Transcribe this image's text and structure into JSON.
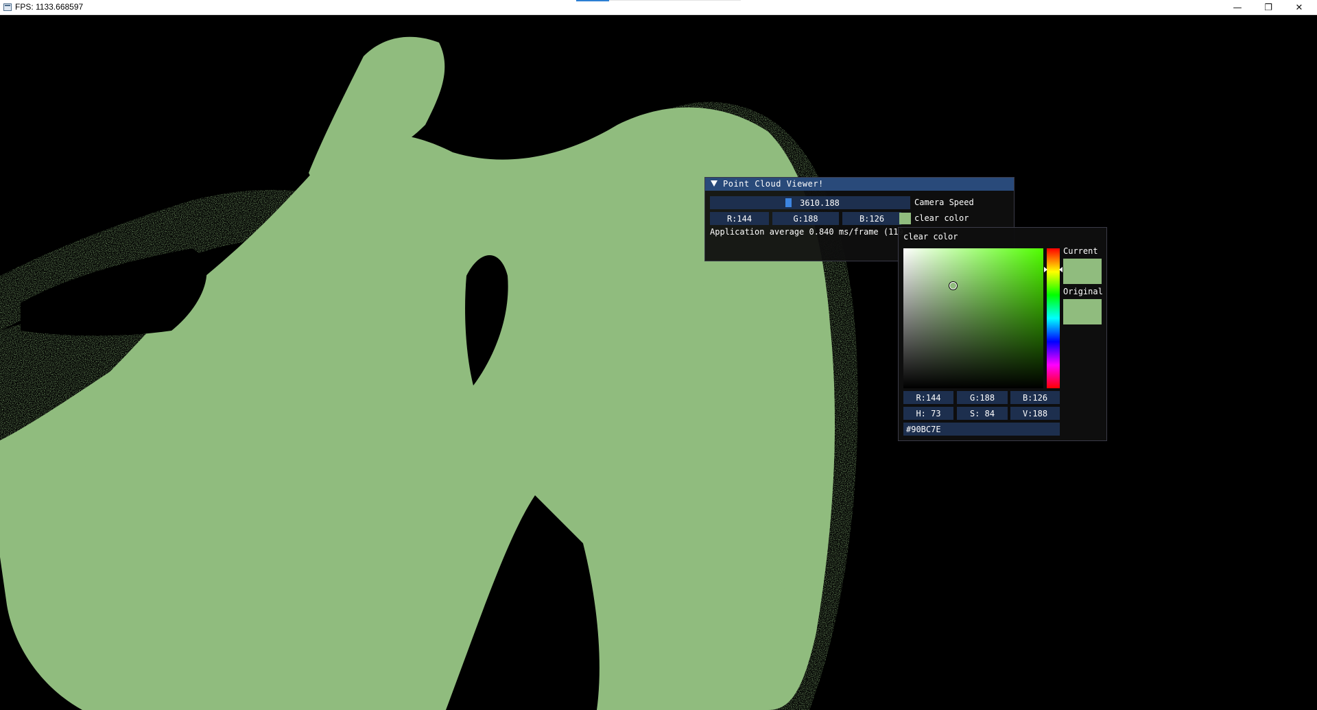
{
  "window": {
    "title": "FPS: 1133.668597",
    "minimize_glyph": "—",
    "maximize_glyph": "❐",
    "close_glyph": "✕"
  },
  "scene": {
    "point_color": "#90BC7E",
    "background": "#000000"
  },
  "panel": {
    "title": "Point Cloud Viewer!",
    "camera_speed": {
      "value": "3610.188",
      "label": "Camera Speed"
    },
    "clear_color": {
      "r": "R:144",
      "g": "G:188",
      "b": "B:126",
      "label": "clear color",
      "swatch": "#90BC7E"
    },
    "stats": "Application average 0.840 ms/frame (119"
  },
  "picker": {
    "title": "clear color",
    "current_label": "Current",
    "original_label": "Original",
    "rgb": {
      "r": "R:144",
      "g": "G:188",
      "b": "B:126"
    },
    "hsv": {
      "h": "H: 73",
      "s": "S: 84",
      "v": "V:188"
    },
    "hex": "#90BC7E",
    "hue_color": "#50FF00"
  }
}
